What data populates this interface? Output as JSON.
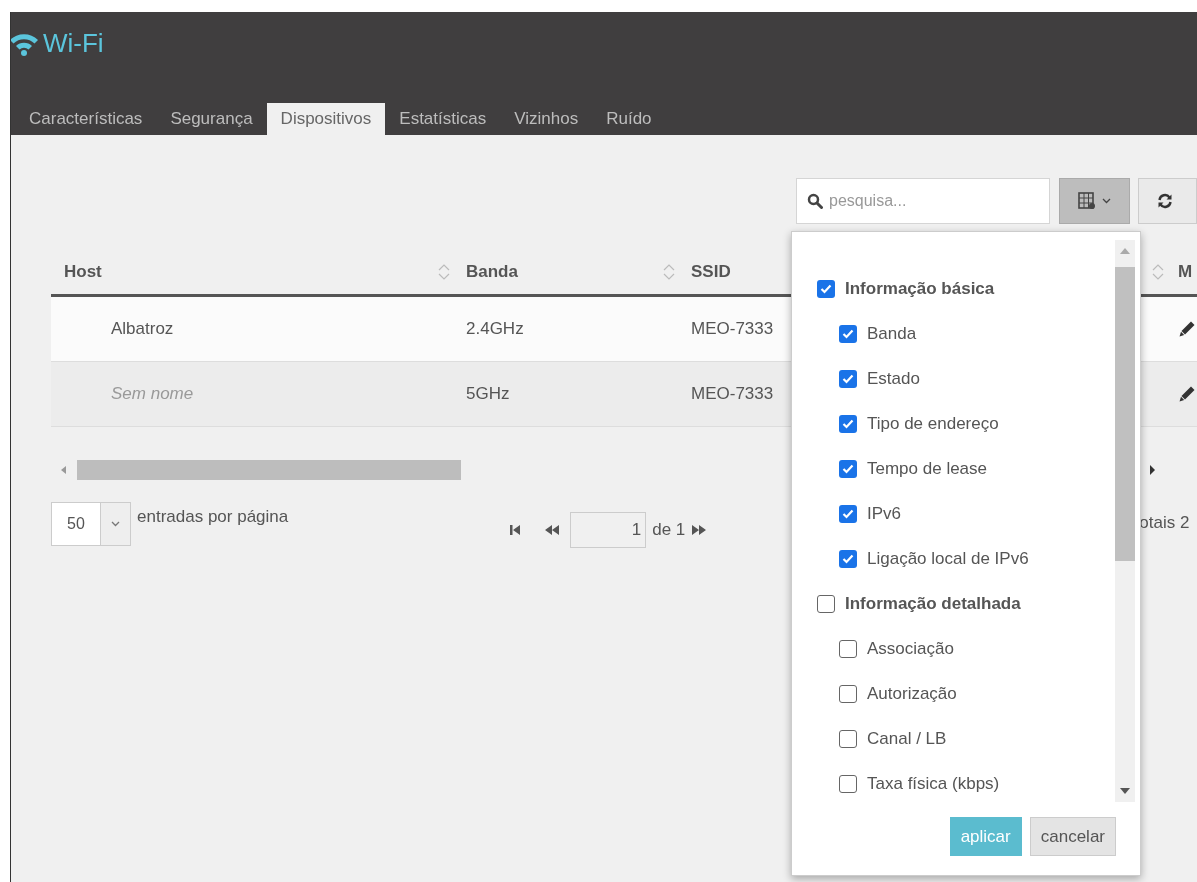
{
  "header": {
    "title": "Wi-Fi"
  },
  "tabs": [
    {
      "label": "Características",
      "selected": false
    },
    {
      "label": "Segurança",
      "selected": false
    },
    {
      "label": "Dispositivos",
      "selected": true
    },
    {
      "label": "Estatísticas",
      "selected": false
    },
    {
      "label": "Vizinhos",
      "selected": false
    },
    {
      "label": "Ruído",
      "selected": false
    }
  ],
  "search": {
    "placeholder": "pesquisa..."
  },
  "table": {
    "columns": [
      "Host",
      "Banda",
      "SSID",
      "M"
    ],
    "rows": [
      {
        "host": "Albatroz",
        "kind": "named",
        "band": "2.4GHz",
        "ssid": "MEO-7333",
        "selected": true
      },
      {
        "host": "Sem nome",
        "kind": "unnamed",
        "band": "5GHz",
        "ssid": "MEO-7333",
        "selected": false
      }
    ]
  },
  "pagination": {
    "page_size": "50",
    "page_size_label": "entradas por página",
    "page": "1",
    "of_text": "de 1",
    "totals_text": "otais 2"
  },
  "column_menu": {
    "groups": [
      {
        "label": "Informação básica",
        "checked": true,
        "children": [
          {
            "label": "Banda",
            "checked": true
          },
          {
            "label": "Estado",
            "checked": true
          },
          {
            "label": "Tipo de endereço",
            "checked": true
          },
          {
            "label": "Tempo de lease",
            "checked": true
          },
          {
            "label": "IPv6",
            "checked": true
          },
          {
            "label": "Ligação local de IPv6",
            "checked": true
          }
        ]
      },
      {
        "label": "Informação detalhada",
        "checked": false,
        "children": [
          {
            "label": "Associação",
            "checked": false
          },
          {
            "label": "Autorização",
            "checked": false
          },
          {
            "label": "Canal / LB",
            "checked": false
          },
          {
            "label": "Taxa física (kbps)",
            "checked": false
          }
        ]
      }
    ],
    "apply": "aplicar",
    "cancel": "cancelar"
  }
}
